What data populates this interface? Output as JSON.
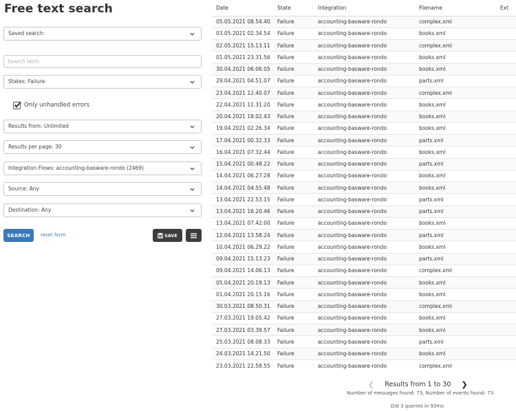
{
  "title": "Free text search",
  "form": {
    "saved_search": "Saved search:",
    "search_placeholder": "Search term",
    "states": "States: Failure",
    "only_unhandled": "Only unhandled errors",
    "results_from": "Results from: Unlimited",
    "results_per_page": "Results per page: 30",
    "integration_flows": "Integration Flows: accounting-basware-rondo (2469)",
    "source": "Source: Any",
    "destination": "Destination: Any",
    "search_button": "SEARCH",
    "reset_link": "reset form",
    "save_button": "SAVE"
  },
  "table": {
    "headers": [
      "Date",
      "State",
      "Integration",
      "Filename",
      "Ext"
    ],
    "rows": [
      [
        "05.05.2021 08.54.40",
        "Failure",
        "accounting-basware-rondo",
        "complex.xml"
      ],
      [
        "03.05.2021 02.34.54",
        "Failure",
        "accounting-basware-rondo",
        "books.xml"
      ],
      [
        "02.05.2021 15.13.11",
        "Failure",
        "accounting-basware-rondo",
        "complex.xml"
      ],
      [
        "01.05.2021 23.31.56",
        "Failure",
        "accounting-basware-rondo",
        "books.xml"
      ],
      [
        "30.04.2021 06.06.05",
        "Failure",
        "accounting-basware-rondo",
        "books.xml"
      ],
      [
        "29.04.2021 04.51.07",
        "Failure",
        "accounting-basware-rondo",
        "parts.xml"
      ],
      [
        "23.04.2021 12.40.07",
        "Failure",
        "accounting-basware-rondo",
        "complex.xml"
      ],
      [
        "22.04.2021 11.31.20",
        "Failure",
        "accounting-basware-rondo",
        "books.xml"
      ],
      [
        "20.04.2021 18.02.43",
        "Failure",
        "accounting-basware-rondo",
        "books.xml"
      ],
      [
        "19.04.2021 02.26.34",
        "Failure",
        "accounting-basware-rondo",
        "books.xml"
      ],
      [
        "17.04.2021 00.32.33",
        "Failure",
        "accounting-basware-rondo",
        "parts.xml"
      ],
      [
        "16.04.2021 07.32.44",
        "Failure",
        "accounting-basware-rondo",
        "books.xml"
      ],
      [
        "15.04.2021 00.48.22",
        "Failure",
        "accounting-basware-rondo",
        "parts.xml"
      ],
      [
        "14.04.2021 06.27.28",
        "Failure",
        "accounting-basware-rondo",
        "books.xml"
      ],
      [
        "14.04.2021 04.55.48",
        "Failure",
        "accounting-basware-rondo",
        "books.xml"
      ],
      [
        "13.04.2021 22.53.15",
        "Failure",
        "accounting-basware-rondo",
        "parts.xml"
      ],
      [
        "13.04.2021 16.20.46",
        "Failure",
        "accounting-basware-rondo",
        "parts.xml"
      ],
      [
        "13.04.2021 07.42.00",
        "Failure",
        "accounting-basware-rondo",
        "books.xml"
      ],
      [
        "12.04.2021 13.58.24",
        "Failure",
        "accounting-basware-rondo",
        "parts.xml"
      ],
      [
        "10.04.2021 06.29.22",
        "Failure",
        "accounting-basware-rondo",
        "books.xml"
      ],
      [
        "09.04.2021 15.13.23",
        "Failure",
        "accounting-basware-rondo",
        "parts.xml"
      ],
      [
        "09.04.2021 14.06.13",
        "Failure",
        "accounting-basware-rondo",
        "complex.xml"
      ],
      [
        "05.04.2021 20.19.13",
        "Failure",
        "accounting-basware-rondo",
        "books.xml"
      ],
      [
        "01.04.2021 20.15.16",
        "Failure",
        "accounting-basware-rondo",
        "books.xml"
      ],
      [
        "30.03.2021 08.50.31",
        "Failure",
        "accounting-basware-rondo",
        "complex.xml"
      ],
      [
        "27.03.2021 19.05.42",
        "Failure",
        "accounting-basware-rondo",
        "books.xml"
      ],
      [
        "27.03.2021 03.39.57",
        "Failure",
        "accounting-basware-rondo",
        "books.xml"
      ],
      [
        "25.03.2021 08.08.33",
        "Failure",
        "accounting-basware-rondo",
        "parts.xml"
      ],
      [
        "24.03.2021 14.21.50",
        "Failure",
        "accounting-basware-rondo",
        "books.xml"
      ],
      [
        "23.03.2021 22.58.55",
        "Failure",
        "accounting-basware-rondo",
        "complex.xml"
      ]
    ]
  },
  "pagination": {
    "label": "Results from 1 to 30",
    "found": "Number of messages found: 73, Number of events found: 73",
    "queries": "Did 3 queries in 93ms"
  },
  "icons": {
    "chevron": "chevron-down-icon",
    "check": "check-icon",
    "save": "floppy-disk-icon",
    "menu": "hamburger-menu-icon",
    "prev": "chevron-left-icon",
    "next": "chevron-right-icon"
  },
  "colors": {
    "primary": "#3b7ab8",
    "dark_button": "#3d3d3d"
  }
}
